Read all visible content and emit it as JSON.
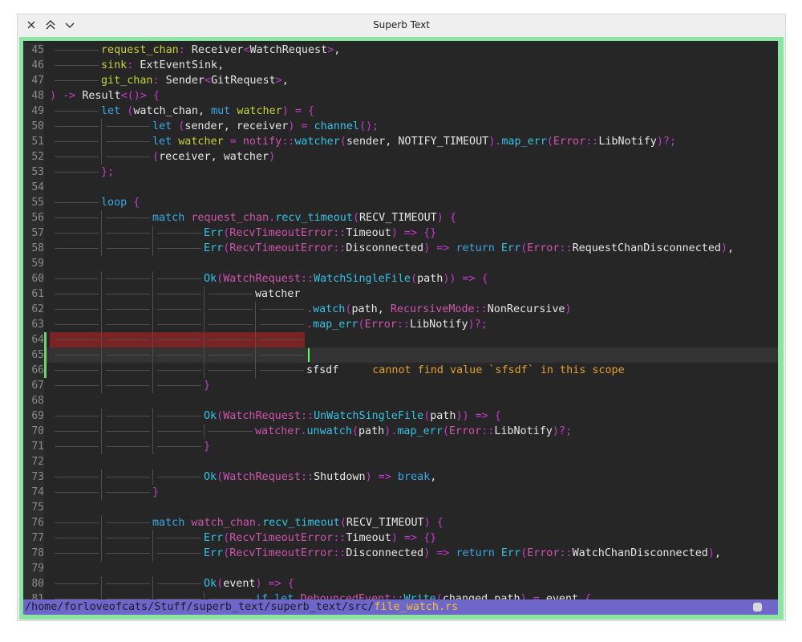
{
  "window": {
    "title": "Superb Text",
    "buttons": {
      "close": "close-icon",
      "maximize": "chevrons-up-icon",
      "minimize": "chevron-down-icon"
    }
  },
  "colors": {
    "frame": "#8be4a1",
    "editor_bg": "#262626",
    "error_highlight": "#7a2323",
    "statusbar": "#6e66c9",
    "current_file": "#f4c12e",
    "cursor": "#5bff5b",
    "indent_guide": "#4f4f4f"
  },
  "editor": {
    "first_line": 45,
    "current_line": 65,
    "error_highlight_lines": [
      64,
      65
    ],
    "lines": [
      {
        "n": "45",
        "i": 1,
        "t": [
          [
            "request_chan",
            "var"
          ],
          [
            ": ",
            "pun"
          ],
          [
            "Receiver",
            "plain"
          ],
          [
            "<",
            "pun"
          ],
          [
            "WatchRequest",
            "plain"
          ],
          [
            ">",
            "pun"
          ],
          [
            ",",
            "plain"
          ]
        ]
      },
      {
        "n": "46",
        "i": 1,
        "t": [
          [
            "sink",
            "var"
          ],
          [
            ": ",
            "pun"
          ],
          [
            "ExtEventSink",
            "plain"
          ],
          [
            ",",
            "plain"
          ]
        ]
      },
      {
        "n": "47",
        "i": 1,
        "t": [
          [
            "git_chan",
            "var"
          ],
          [
            ": ",
            "pun"
          ],
          [
            "Sender",
            "plain"
          ],
          [
            "<",
            "pun"
          ],
          [
            "GitRequest",
            "plain"
          ],
          [
            ">",
            "pun"
          ],
          [
            ",",
            "plain"
          ]
        ]
      },
      {
        "n": "48",
        "i": 0,
        "t": [
          [
            ")",
            "pun"
          ],
          [
            " -> ",
            "pun"
          ],
          [
            "Result",
            "plain"
          ],
          [
            "<()>",
            "pun"
          ],
          [
            " {",
            "pun"
          ]
        ]
      },
      {
        "n": "49",
        "i": 1,
        "t": [
          [
            "let",
            "kw"
          ],
          [
            " (",
            "pun"
          ],
          [
            "watch_chan",
            "plain"
          ],
          [
            ", ",
            "plain"
          ],
          [
            "mut",
            "kw"
          ],
          [
            " ",
            "plain"
          ],
          [
            "watcher",
            "var"
          ],
          [
            ") = {",
            "pun"
          ]
        ]
      },
      {
        "n": "50",
        "i": 2,
        "t": [
          [
            "let",
            "kw"
          ],
          [
            " (",
            "pun"
          ],
          [
            "sender",
            "plain"
          ],
          [
            ", ",
            "plain"
          ],
          [
            "receiver",
            "plain"
          ],
          [
            ") = ",
            "pun"
          ],
          [
            "channel",
            "fn"
          ],
          [
            "();",
            "pun"
          ]
        ]
      },
      {
        "n": "51",
        "i": 2,
        "t": [
          [
            "let",
            "kw"
          ],
          [
            " ",
            "plain"
          ],
          [
            "watcher",
            "var"
          ],
          [
            " = ",
            "pun"
          ],
          [
            "notify",
            "ty"
          ],
          [
            "::",
            "pun"
          ],
          [
            "watcher",
            "fn"
          ],
          [
            "(",
            "pun"
          ],
          [
            "sender",
            "plain"
          ],
          [
            ", ",
            "plain"
          ],
          [
            "NOTIFY_TIMEOUT",
            "plain"
          ],
          [
            ").",
            "pun"
          ],
          [
            "map_err",
            "fn"
          ],
          [
            "(",
            "pun"
          ],
          [
            "Error",
            "ty"
          ],
          [
            "::",
            "pun"
          ],
          [
            "LibNotify",
            "plain"
          ],
          [
            ")?;",
            "pun"
          ]
        ]
      },
      {
        "n": "52",
        "i": 2,
        "t": [
          [
            "(",
            "pun"
          ],
          [
            "receiver",
            "plain"
          ],
          [
            ", ",
            "plain"
          ],
          [
            "watcher",
            "plain"
          ],
          [
            ")",
            "pun"
          ]
        ]
      },
      {
        "n": "53",
        "i": 1,
        "t": [
          [
            "};",
            "pun"
          ]
        ]
      },
      {
        "n": "54",
        "i": 0,
        "t": []
      },
      {
        "n": "55",
        "i": 1,
        "t": [
          [
            "loop",
            "kw"
          ],
          [
            " {",
            "pun"
          ]
        ]
      },
      {
        "n": "56",
        "i": 2,
        "t": [
          [
            "match",
            "kw"
          ],
          [
            " ",
            "plain"
          ],
          [
            "request_chan",
            "ty"
          ],
          [
            ".",
            "pun"
          ],
          [
            "recv_timeout",
            "fn"
          ],
          [
            "(",
            "pun"
          ],
          [
            "RECV_TIMEOUT",
            "plain"
          ],
          [
            ") {",
            "pun"
          ]
        ]
      },
      {
        "n": "57",
        "i": 3,
        "t": [
          [
            "Err",
            "fn"
          ],
          [
            "(",
            "pun"
          ],
          [
            "RecvTimeoutError",
            "ty"
          ],
          [
            "::",
            "pun"
          ],
          [
            "Timeout",
            "plain"
          ],
          [
            ") => {}",
            "pun"
          ]
        ]
      },
      {
        "n": "58",
        "i": 3,
        "t": [
          [
            "Err",
            "fn"
          ],
          [
            "(",
            "pun"
          ],
          [
            "RecvTimeoutError",
            "ty"
          ],
          [
            "::",
            "pun"
          ],
          [
            "Disconnected",
            "plain"
          ],
          [
            ") => ",
            "pun"
          ],
          [
            "return",
            "kw"
          ],
          [
            " ",
            "plain"
          ],
          [
            "Err",
            "fn"
          ],
          [
            "(",
            "pun"
          ],
          [
            "Error",
            "ty"
          ],
          [
            "::",
            "pun"
          ],
          [
            "RequestChanDisconnected",
            "plain"
          ],
          [
            ")",
            "pun"
          ],
          [
            ",",
            "plain"
          ]
        ]
      },
      {
        "n": "59",
        "i": 0,
        "t": []
      },
      {
        "n": "60",
        "i": 3,
        "t": [
          [
            "Ok",
            "fn"
          ],
          [
            "(",
            "pun"
          ],
          [
            "WatchRequest",
            "ty"
          ],
          [
            "::",
            "pun"
          ],
          [
            "WatchSingleFile",
            "fn"
          ],
          [
            "(",
            "pun"
          ],
          [
            "path",
            "plain"
          ],
          [
            ")) => {",
            "pun"
          ]
        ]
      },
      {
        "n": "61",
        "i": 4,
        "t": [
          [
            "watcher",
            "plain"
          ]
        ]
      },
      {
        "n": "62",
        "i": 5,
        "t": [
          [
            ".",
            "pun"
          ],
          [
            "watch",
            "fn"
          ],
          [
            "(",
            "pun"
          ],
          [
            "path",
            "plain"
          ],
          [
            ", ",
            "plain"
          ],
          [
            "RecursiveMode",
            "ty"
          ],
          [
            "::",
            "pun"
          ],
          [
            "NonRecursive",
            "plain"
          ],
          [
            ")",
            "pun"
          ]
        ]
      },
      {
        "n": "63",
        "i": 5,
        "t": [
          [
            ".",
            "pun"
          ],
          [
            "map_err",
            "fn"
          ],
          [
            "(",
            "pun"
          ],
          [
            "Error",
            "ty"
          ],
          [
            "::",
            "pun"
          ],
          [
            "LibNotify",
            "plain"
          ],
          [
            ")?;",
            "pun"
          ]
        ]
      },
      {
        "n": "64",
        "i": 5,
        "t": []
      },
      {
        "n": "65",
        "i": 5,
        "t": []
      },
      {
        "n": "66",
        "i": 5,
        "t": [
          [
            "sfsdf",
            "plain"
          ]
        ],
        "err": "cannot find value `sfsdf` in this scope"
      },
      {
        "n": "67",
        "i": 3,
        "t": [
          [
            "}",
            "pun"
          ]
        ]
      },
      {
        "n": "68",
        "i": 0,
        "t": []
      },
      {
        "n": "69",
        "i": 3,
        "t": [
          [
            "Ok",
            "fn"
          ],
          [
            "(",
            "pun"
          ],
          [
            "WatchRequest",
            "ty"
          ],
          [
            "::",
            "pun"
          ],
          [
            "UnWatchSingleFile",
            "fn"
          ],
          [
            "(",
            "pun"
          ],
          [
            "path",
            "plain"
          ],
          [
            ")) => {",
            "pun"
          ]
        ]
      },
      {
        "n": "70",
        "i": 4,
        "t": [
          [
            "watcher",
            "ty"
          ],
          [
            ".",
            "pun"
          ],
          [
            "unwatch",
            "fn"
          ],
          [
            "(",
            "pun"
          ],
          [
            "path",
            "plain"
          ],
          [
            ").",
            "pun"
          ],
          [
            "map_err",
            "fn"
          ],
          [
            "(",
            "pun"
          ],
          [
            "Error",
            "ty"
          ],
          [
            "::",
            "pun"
          ],
          [
            "LibNotify",
            "plain"
          ],
          [
            ")?;",
            "pun"
          ]
        ]
      },
      {
        "n": "71",
        "i": 3,
        "t": [
          [
            "}",
            "pun"
          ]
        ]
      },
      {
        "n": "72",
        "i": 0,
        "t": []
      },
      {
        "n": "73",
        "i": 3,
        "t": [
          [
            "Ok",
            "fn"
          ],
          [
            "(",
            "pun"
          ],
          [
            "WatchRequest",
            "ty"
          ],
          [
            "::",
            "pun"
          ],
          [
            "Shutdown",
            "plain"
          ],
          [
            ") => ",
            "pun"
          ],
          [
            "break",
            "kw"
          ],
          [
            ",",
            "plain"
          ]
        ]
      },
      {
        "n": "74",
        "i": 2,
        "t": [
          [
            "}",
            "pun"
          ]
        ]
      },
      {
        "n": "75",
        "i": 0,
        "t": []
      },
      {
        "n": "76",
        "i": 2,
        "t": [
          [
            "match",
            "kw"
          ],
          [
            " ",
            "plain"
          ],
          [
            "watch_chan",
            "ty"
          ],
          [
            ".",
            "pun"
          ],
          [
            "recv_timeout",
            "fn"
          ],
          [
            "(",
            "pun"
          ],
          [
            "RECV_TIMEOUT",
            "plain"
          ],
          [
            ") {",
            "pun"
          ]
        ]
      },
      {
        "n": "77",
        "i": 3,
        "t": [
          [
            "Err",
            "fn"
          ],
          [
            "(",
            "pun"
          ],
          [
            "RecvTimeoutError",
            "ty"
          ],
          [
            "::",
            "pun"
          ],
          [
            "Timeout",
            "plain"
          ],
          [
            ") => {}",
            "pun"
          ]
        ]
      },
      {
        "n": "78",
        "i": 3,
        "t": [
          [
            "Err",
            "fn"
          ],
          [
            "(",
            "pun"
          ],
          [
            "RecvTimeoutError",
            "ty"
          ],
          [
            "::",
            "pun"
          ],
          [
            "Disconnected",
            "plain"
          ],
          [
            ") => ",
            "pun"
          ],
          [
            "return",
            "kw"
          ],
          [
            " ",
            "plain"
          ],
          [
            "Err",
            "fn"
          ],
          [
            "(",
            "pun"
          ],
          [
            "Error",
            "ty"
          ],
          [
            "::",
            "pun"
          ],
          [
            "WatchChanDisconnected",
            "plain"
          ],
          [
            ")",
            "pun"
          ],
          [
            ",",
            "plain"
          ]
        ]
      },
      {
        "n": "79",
        "i": 0,
        "t": []
      },
      {
        "n": "80",
        "i": 3,
        "t": [
          [
            "Ok",
            "fn"
          ],
          [
            "(",
            "pun"
          ],
          [
            "event",
            "plain"
          ],
          [
            ") => {",
            "pun"
          ]
        ]
      },
      {
        "n": "81",
        "i": 4,
        "t": [
          [
            "if",
            "kw"
          ],
          [
            " ",
            "plain"
          ],
          [
            "let",
            "kw"
          ],
          [
            " ",
            "plain"
          ],
          [
            "DebouncedEvent",
            "ty"
          ],
          [
            "::",
            "pun"
          ],
          [
            "Write",
            "fn"
          ],
          [
            "(",
            "pun"
          ],
          [
            "changed_path",
            "plain"
          ],
          [
            ") = ",
            "pun"
          ],
          [
            "event",
            "plain"
          ],
          [
            " {",
            "pun"
          ]
        ]
      }
    ]
  },
  "statusbar": {
    "dir": "/home/forloveofcats/Stuff/superb_text/superb_text/src/",
    "file": "file_watch.rs"
  }
}
